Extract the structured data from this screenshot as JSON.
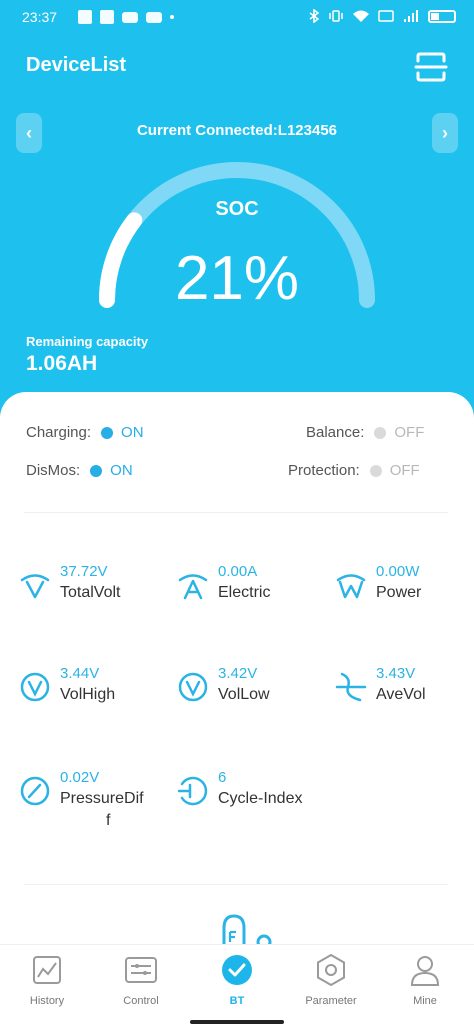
{
  "status_bar": {
    "time": "23:37"
  },
  "header": {
    "title": "DeviceList",
    "scan_icon": "scan-frame-icon"
  },
  "connection": {
    "text": "Current Connected:L123456"
  },
  "gauge": {
    "label": "SOC",
    "value_text": "21%",
    "percent": 21
  },
  "remaining": {
    "label": "Remaining capacity",
    "value": "1.06AH"
  },
  "states": [
    {
      "label": "Charging:",
      "value": "ON",
      "on": true
    },
    {
      "label": "Balance:",
      "value": "OFF",
      "on": false
    },
    {
      "label": "DisMos:",
      "value": "ON",
      "on": true
    },
    {
      "label": "Protection:",
      "value": "OFF",
      "on": false
    }
  ],
  "metrics": [
    {
      "value": "37.72V",
      "label": "TotalVolt",
      "icon": "total-volt-icon"
    },
    {
      "value": "0.00A",
      "label": "Electric",
      "icon": "electric-current-icon"
    },
    {
      "value": "0.00W",
      "label": "Power",
      "icon": "power-icon"
    },
    {
      "value": "3.44V",
      "label": "VolHigh",
      "icon": "voltage-high-icon"
    },
    {
      "value": "3.42V",
      "label": "VolLow",
      "icon": "voltage-low-icon"
    },
    {
      "value": "3.43V",
      "label": "AveVol",
      "icon": "average-voltage-icon"
    },
    {
      "value": "0.02V",
      "label": "PressureDif",
      "label2": "f",
      "icon": "pressure-diff-icon"
    },
    {
      "value": "6",
      "label": "Cycle-Index",
      "icon": "cycle-index-icon"
    }
  ],
  "tabs": [
    {
      "label": "History",
      "icon": "history-chart-icon",
      "active": false
    },
    {
      "label": "Control",
      "icon": "control-panel-icon",
      "active": false
    },
    {
      "label": "BT",
      "icon": "bluetooth-check-icon",
      "active": true
    },
    {
      "label": "Parameter",
      "icon": "parameter-hexagon-icon",
      "active": false
    },
    {
      "label": "Mine",
      "icon": "user-icon",
      "active": false
    }
  ],
  "colors": {
    "primary": "#1ec0ee",
    "accent": "#27aee6",
    "off": "#dadada"
  }
}
